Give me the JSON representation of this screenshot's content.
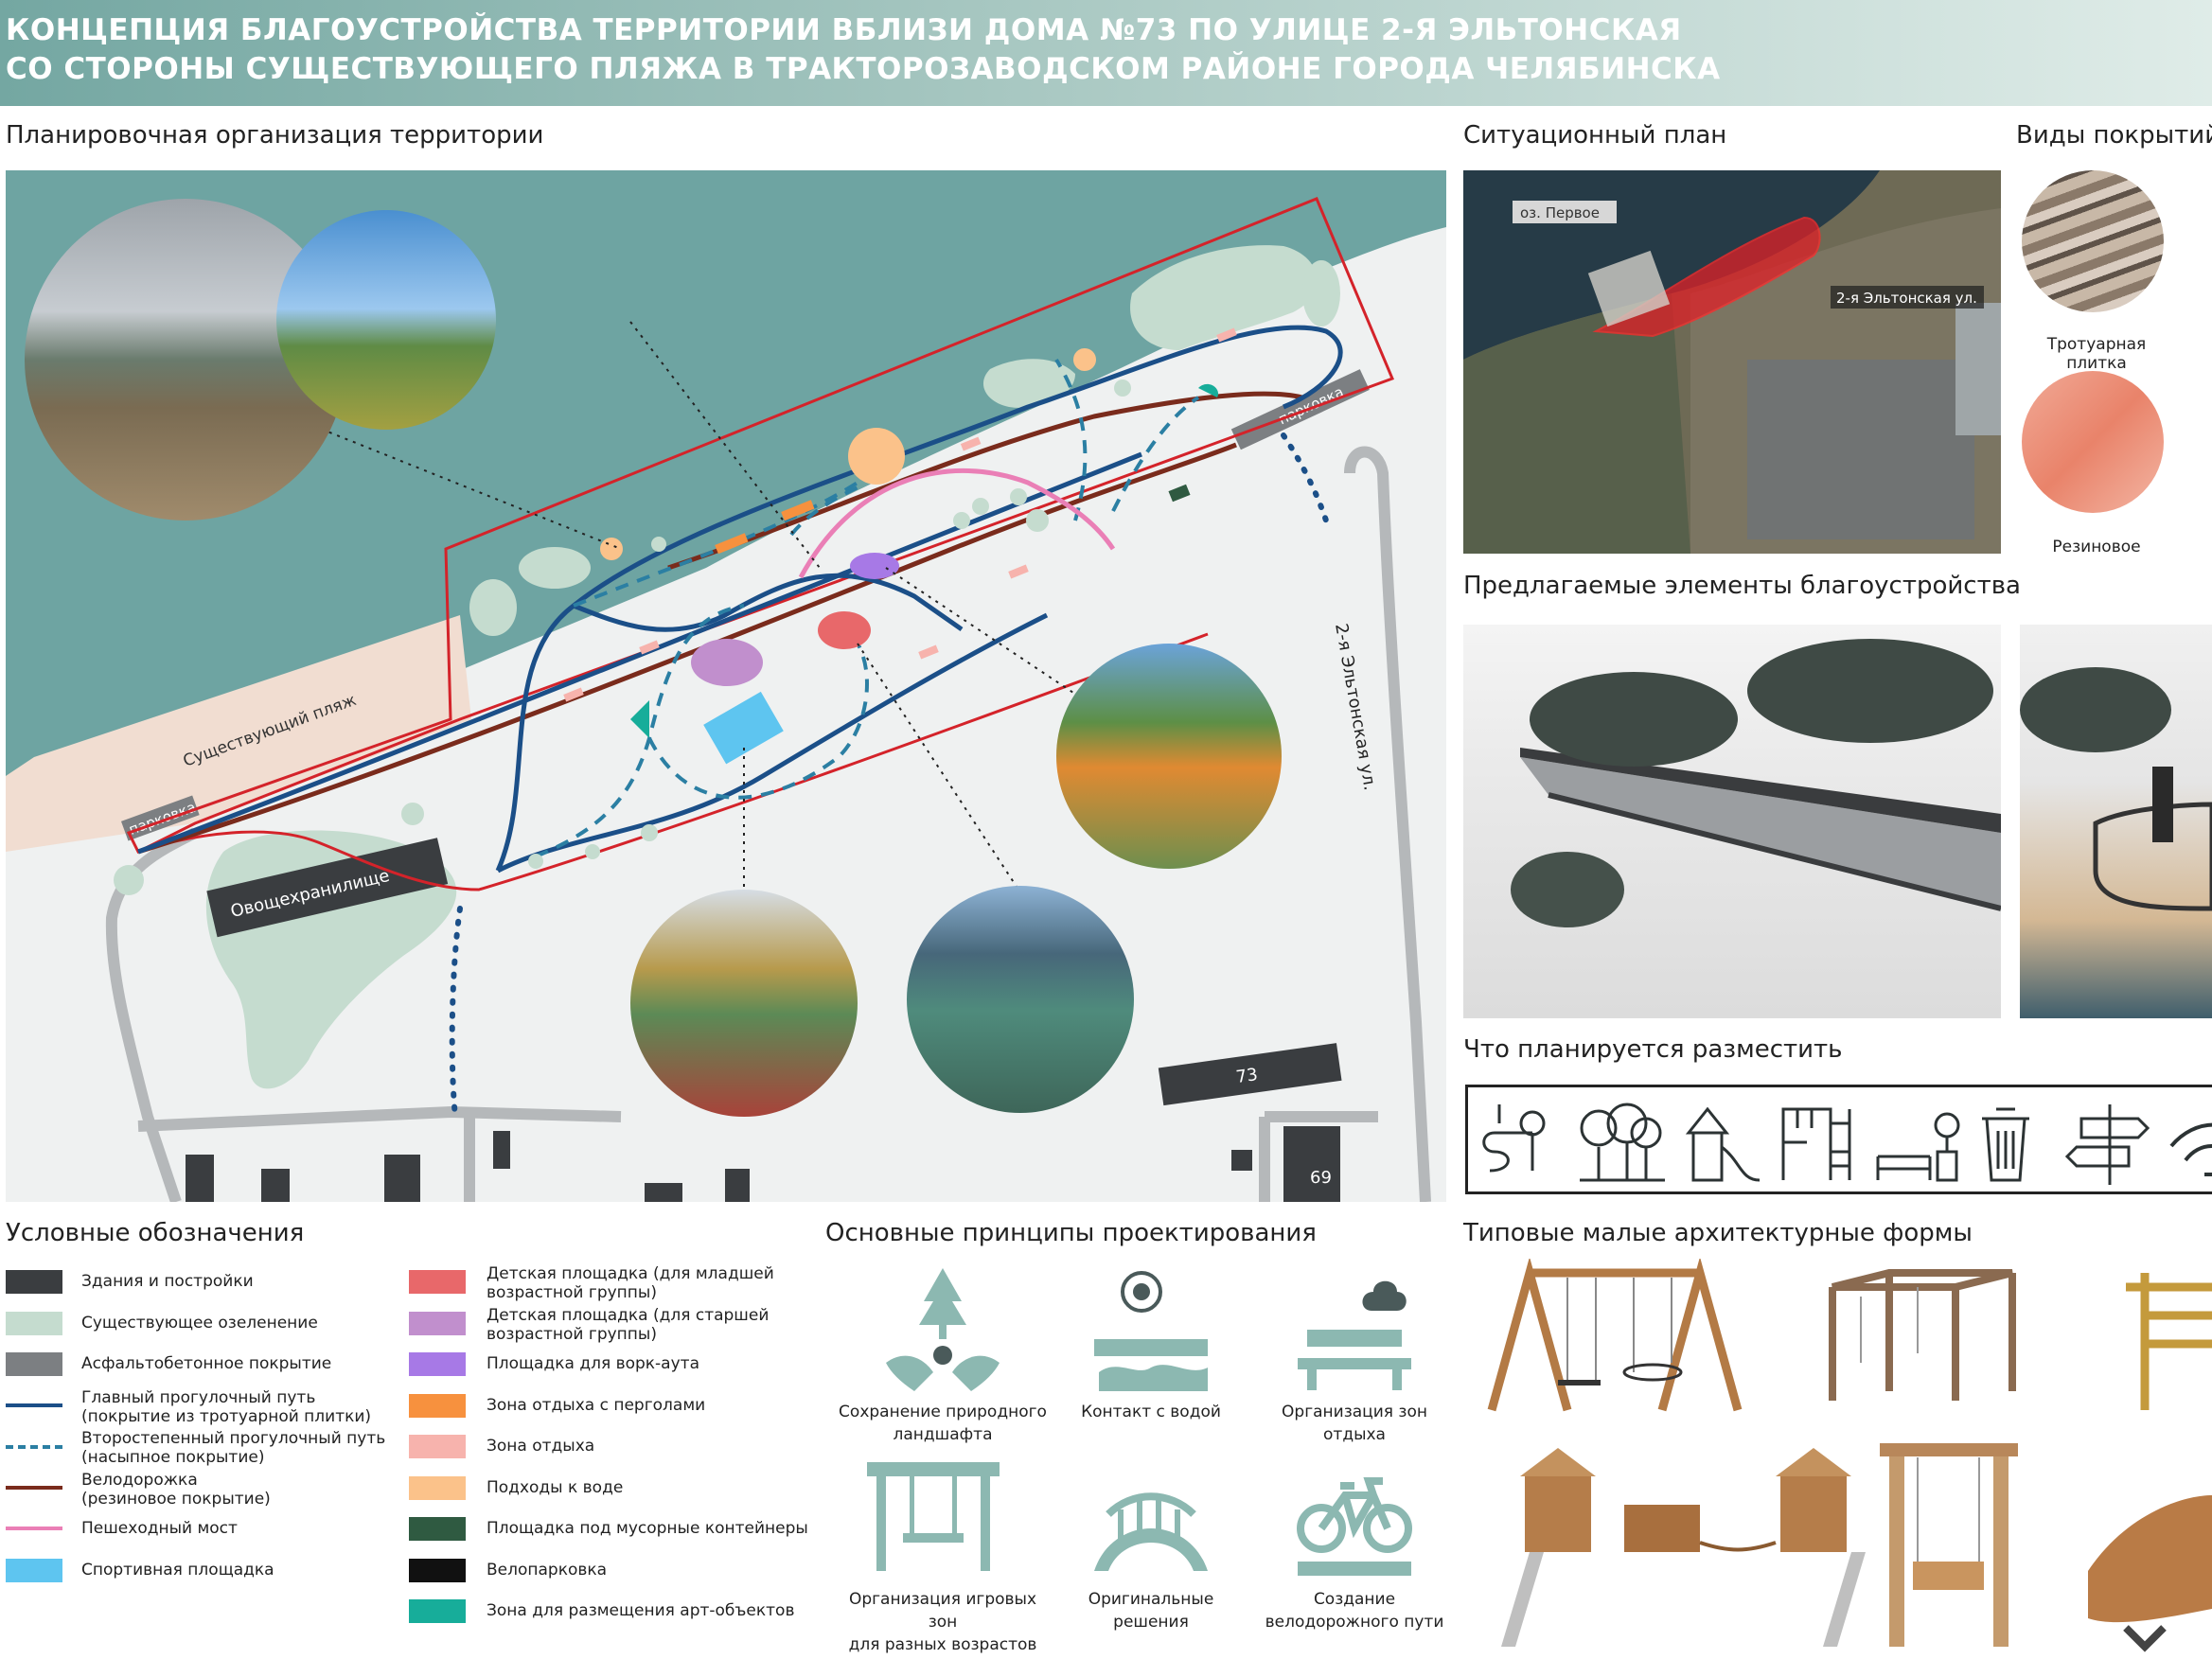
{
  "header": {
    "line1": "КОНЦЕПЦИЯ БЛАГОУСТРОЙСТВА ТЕРРИТОРИИ ВБЛИЗИ ДОМА №73 ПО УЛИЦЕ 2-Я ЭЛЬТОНСКАЯ",
    "line2": "СО СТОРОНЫ СУЩЕСТВУЮЩЕГО ПЛЯЖА В ТРАКТОРОЗАВОДСКОМ РАЙОНЕ ГОРОДА ЧЕЛЯБИНСКА"
  },
  "sections": {
    "plan": "Планировочная организация территории",
    "situation": "Ситуационный план",
    "coverings": "Виды покрытий",
    "proposed": "Предлагаемые элементы благоустройства",
    "planned": "Что планируется разместить",
    "legend": "Условные обозначения",
    "principles": "Основные принципы проектирования",
    "maf": "Типовые малые архитектурные формы"
  },
  "map_labels": {
    "beach": "Существующий пляж",
    "parking_left": "парковка",
    "parking_right": "парковка",
    "storage": "Овощехранилище",
    "street": "2-я Эльтонская ул.",
    "house73": "73",
    "house69": "69"
  },
  "situation_labels": {
    "lake": "оз. Первое",
    "street": "2-я Эльтонская ул."
  },
  "coverings": [
    {
      "label": "Тротуарная плитка"
    },
    {
      "label": "Резиновое"
    }
  ],
  "legend_left": [
    {
      "color": "#3a3d40",
      "label": "Здания и постройки",
      "kind": "box"
    },
    {
      "color": "#c5dccf",
      "label": "Существующее озеленение",
      "kind": "box"
    },
    {
      "color": "#7c7f82",
      "label": "Асфальтобетонное покрытие",
      "kind": "box"
    },
    {
      "color": "#1b4f88",
      "label": "Главный прогулочный путь\n(покрытие из тротуарной плитки)",
      "kind": "line"
    },
    {
      "color": "#2b7fa3",
      "label": "Второстепенный прогулочный путь\n(насыпное покрытие)",
      "kind": "dash"
    },
    {
      "color": "#7a2b1c",
      "label": "Велодорожка\n(резиновое покрытие)",
      "kind": "line"
    },
    {
      "color": "#ea7fb6",
      "label": "Пешеходный мост",
      "kind": "line"
    },
    {
      "color": "#5ec5f0",
      "label": "Спортивная площадка",
      "kind": "box"
    }
  ],
  "legend_right": [
    {
      "color": "#e8686a",
      "label": "Детская площадка (для младшей\nвозрастной группы)"
    },
    {
      "color": "#c18fcd",
      "label": "Детская площадка (для старшей\nвозрастной группы)"
    },
    {
      "color": "#a779e6",
      "label": "Площадка для ворк-аута"
    },
    {
      "color": "#f7913e",
      "label": "Зона отдыха с перголами"
    },
    {
      "color": "#f7b3ad",
      "label": "Зона отдыха"
    },
    {
      "color": "#fbc28a",
      "label": "Подходы к воде"
    },
    {
      "color": "#2f5a41",
      "label": "Площадка под мусорные контейнеры"
    },
    {
      "color": "#111111",
      "label": "Велопарковка"
    },
    {
      "color": "#17ad9a",
      "label": "Зона для размещения арт-объектов"
    }
  ],
  "principles": [
    {
      "label": "Сохранение природного\nландшафта",
      "icon": "nature-icon"
    },
    {
      "label": "Контакт с водой",
      "icon": "water-icon"
    },
    {
      "label": "Организация зон\nотдыха",
      "icon": "bench-cloud-icon"
    },
    {
      "label": "Организация игровых зон\nдля разных возрастов",
      "icon": "swing-icon"
    },
    {
      "label": "Оригинальные\nрешения",
      "icon": "bridge-icon"
    },
    {
      "label": "Создание\nвелодорожного пути",
      "icon": "bicycle-icon"
    }
  ],
  "colors": {
    "water": "#6ea4a2",
    "ground": "#eff1f1",
    "boundary": "#d4232a",
    "accent": "#74a7a2"
  }
}
